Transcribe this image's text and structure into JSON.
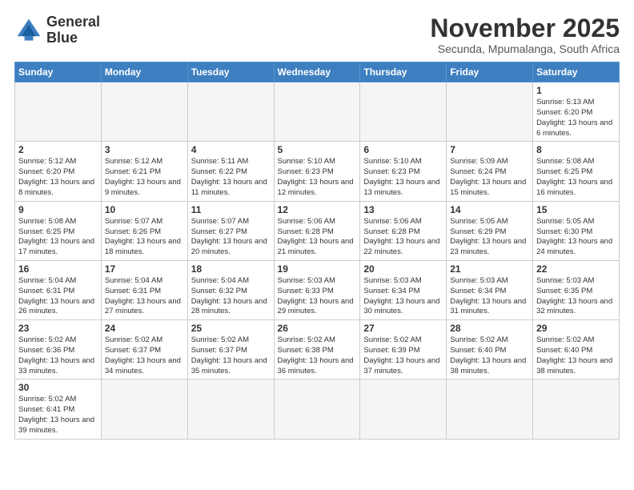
{
  "logo": {
    "line1": "General",
    "line2": "Blue"
  },
  "title": "November 2025",
  "subtitle": "Secunda, Mpumalanga, South Africa",
  "weekdays": [
    "Sunday",
    "Monday",
    "Tuesday",
    "Wednesday",
    "Thursday",
    "Friday",
    "Saturday"
  ],
  "weeks": [
    [
      {
        "day": "",
        "info": ""
      },
      {
        "day": "",
        "info": ""
      },
      {
        "day": "",
        "info": ""
      },
      {
        "day": "",
        "info": ""
      },
      {
        "day": "",
        "info": ""
      },
      {
        "day": "",
        "info": ""
      },
      {
        "day": "1",
        "info": "Sunrise: 5:13 AM\nSunset: 6:20 PM\nDaylight: 13 hours and 6 minutes."
      }
    ],
    [
      {
        "day": "2",
        "info": "Sunrise: 5:12 AM\nSunset: 6:20 PM\nDaylight: 13 hours and 8 minutes."
      },
      {
        "day": "3",
        "info": "Sunrise: 5:12 AM\nSunset: 6:21 PM\nDaylight: 13 hours and 9 minutes."
      },
      {
        "day": "4",
        "info": "Sunrise: 5:11 AM\nSunset: 6:22 PM\nDaylight: 13 hours and 11 minutes."
      },
      {
        "day": "5",
        "info": "Sunrise: 5:10 AM\nSunset: 6:23 PM\nDaylight: 13 hours and 12 minutes."
      },
      {
        "day": "6",
        "info": "Sunrise: 5:10 AM\nSunset: 6:23 PM\nDaylight: 13 hours and 13 minutes."
      },
      {
        "day": "7",
        "info": "Sunrise: 5:09 AM\nSunset: 6:24 PM\nDaylight: 13 hours and 15 minutes."
      },
      {
        "day": "8",
        "info": "Sunrise: 5:08 AM\nSunset: 6:25 PM\nDaylight: 13 hours and 16 minutes."
      }
    ],
    [
      {
        "day": "9",
        "info": "Sunrise: 5:08 AM\nSunset: 6:25 PM\nDaylight: 13 hours and 17 minutes."
      },
      {
        "day": "10",
        "info": "Sunrise: 5:07 AM\nSunset: 6:26 PM\nDaylight: 13 hours and 18 minutes."
      },
      {
        "day": "11",
        "info": "Sunrise: 5:07 AM\nSunset: 6:27 PM\nDaylight: 13 hours and 20 minutes."
      },
      {
        "day": "12",
        "info": "Sunrise: 5:06 AM\nSunset: 6:28 PM\nDaylight: 13 hours and 21 minutes."
      },
      {
        "day": "13",
        "info": "Sunrise: 5:06 AM\nSunset: 6:28 PM\nDaylight: 13 hours and 22 minutes."
      },
      {
        "day": "14",
        "info": "Sunrise: 5:05 AM\nSunset: 6:29 PM\nDaylight: 13 hours and 23 minutes."
      },
      {
        "day": "15",
        "info": "Sunrise: 5:05 AM\nSunset: 6:30 PM\nDaylight: 13 hours and 24 minutes."
      }
    ],
    [
      {
        "day": "16",
        "info": "Sunrise: 5:04 AM\nSunset: 6:31 PM\nDaylight: 13 hours and 26 minutes."
      },
      {
        "day": "17",
        "info": "Sunrise: 5:04 AM\nSunset: 6:31 PM\nDaylight: 13 hours and 27 minutes."
      },
      {
        "day": "18",
        "info": "Sunrise: 5:04 AM\nSunset: 6:32 PM\nDaylight: 13 hours and 28 minutes."
      },
      {
        "day": "19",
        "info": "Sunrise: 5:03 AM\nSunset: 6:33 PM\nDaylight: 13 hours and 29 minutes."
      },
      {
        "day": "20",
        "info": "Sunrise: 5:03 AM\nSunset: 6:34 PM\nDaylight: 13 hours and 30 minutes."
      },
      {
        "day": "21",
        "info": "Sunrise: 5:03 AM\nSunset: 6:34 PM\nDaylight: 13 hours and 31 minutes."
      },
      {
        "day": "22",
        "info": "Sunrise: 5:03 AM\nSunset: 6:35 PM\nDaylight: 13 hours and 32 minutes."
      }
    ],
    [
      {
        "day": "23",
        "info": "Sunrise: 5:02 AM\nSunset: 6:36 PM\nDaylight: 13 hours and 33 minutes."
      },
      {
        "day": "24",
        "info": "Sunrise: 5:02 AM\nSunset: 6:37 PM\nDaylight: 13 hours and 34 minutes."
      },
      {
        "day": "25",
        "info": "Sunrise: 5:02 AM\nSunset: 6:37 PM\nDaylight: 13 hours and 35 minutes."
      },
      {
        "day": "26",
        "info": "Sunrise: 5:02 AM\nSunset: 6:38 PM\nDaylight: 13 hours and 36 minutes."
      },
      {
        "day": "27",
        "info": "Sunrise: 5:02 AM\nSunset: 6:39 PM\nDaylight: 13 hours and 37 minutes."
      },
      {
        "day": "28",
        "info": "Sunrise: 5:02 AM\nSunset: 6:40 PM\nDaylight: 13 hours and 38 minutes."
      },
      {
        "day": "29",
        "info": "Sunrise: 5:02 AM\nSunset: 6:40 PM\nDaylight: 13 hours and 38 minutes."
      }
    ],
    [
      {
        "day": "30",
        "info": "Sunrise: 5:02 AM\nSunset: 6:41 PM\nDaylight: 13 hours and 39 minutes."
      },
      {
        "day": "",
        "info": ""
      },
      {
        "day": "",
        "info": ""
      },
      {
        "day": "",
        "info": ""
      },
      {
        "day": "",
        "info": ""
      },
      {
        "day": "",
        "info": ""
      },
      {
        "day": "",
        "info": ""
      }
    ]
  ]
}
